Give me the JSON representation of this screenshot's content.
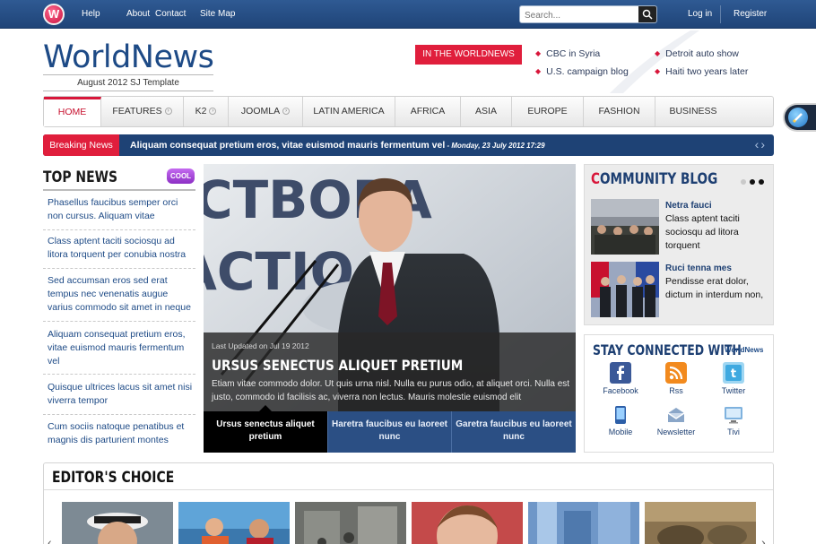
{
  "topbar": {
    "logo_letter": "W",
    "links": [
      "Help",
      "About",
      "Contact",
      "Site Map"
    ],
    "search_placeholder": "Search...",
    "login": "Log in",
    "register": "Register"
  },
  "header": {
    "brand": "WorldNews",
    "tagline": "August 2012 SJ Template",
    "badge": "IN THE WORLDNEWS",
    "headlines": [
      "CBC in Syria",
      "U.S. campaign blog",
      "Detroit auto show",
      "Haiti two years later"
    ]
  },
  "nav": {
    "items": [
      "HOME",
      "FEATURES",
      "K2",
      "JOOMLA",
      "LATIN AMERICA",
      "AFRICA",
      "ASIA",
      "EUROPE",
      "FASHION",
      "BUSINESS"
    ],
    "active": "HOME"
  },
  "breaking": {
    "label": "Breaking News",
    "text": "Aliquam consequat pretium eros, vitae euismod mauris fermentum vel",
    "date": " - Monday, 23 July 2012 17:29"
  },
  "top_news": {
    "title": "TOP NEWS",
    "badge": "COOL",
    "items": [
      "Phasellus faucibus semper orci non cursus. Aliquam vitae",
      "Class aptent taciti sociosqu ad litora torquent per conubia nostra",
      "Sed accumsan eros sed erat tempus nec venenatis augue varius commodo sit amet in neque",
      "Aliquam consequat pretium eros, vitae euismod mauris fermentum vel",
      "Quisque ultrices lacus sit amet nisi viverra tempor",
      "Cum sociis natoque penatibus et magnis dis parturient montes"
    ]
  },
  "slideshow": {
    "photo_sign_text": "CTBOBA\nACTIO",
    "updated": "Last Updated on Jul 19 2012",
    "title": "URSUS SENECTUS ALIQUET PRETIUM",
    "description": "Etiam vitae commodo dolor. Ut quis urna nisl. Nulla eu purus odio, at aliquet orci. Nulla est justo, commodo id facilisis ac, viverra non lectus. Mauris molestie euismod elit",
    "tabs": [
      "Ursus senectus aliquet pretium",
      "Haretra faucibus eu laoreet nunc",
      "Garetra faucibus eu laoreet nunc"
    ]
  },
  "community_blog": {
    "title_first": "C",
    "title_rest": "OMMUNITY BLOG",
    "posts": [
      {
        "author": "Netra fauci",
        "text": "Class aptent taciti sociosqu ad litora torquent"
      },
      {
        "author": "Ruci tenna mes",
        "text": "Pendisse erat dolor, dictum in interdum non,"
      }
    ]
  },
  "stay_connected": {
    "title": "STAY CONNECTED WITH",
    "brand": "WorldNews",
    "items": [
      "Facebook",
      "Rss",
      "Twitter",
      "Mobile",
      "Newsletter",
      "Tivi"
    ]
  },
  "editors_choice": {
    "title": "EDITOR'S CHOICE"
  },
  "colors": {
    "accent_red": "#e01e3c",
    "brand_blue": "#1d4a86",
    "bar_blue": "#1e4275"
  }
}
